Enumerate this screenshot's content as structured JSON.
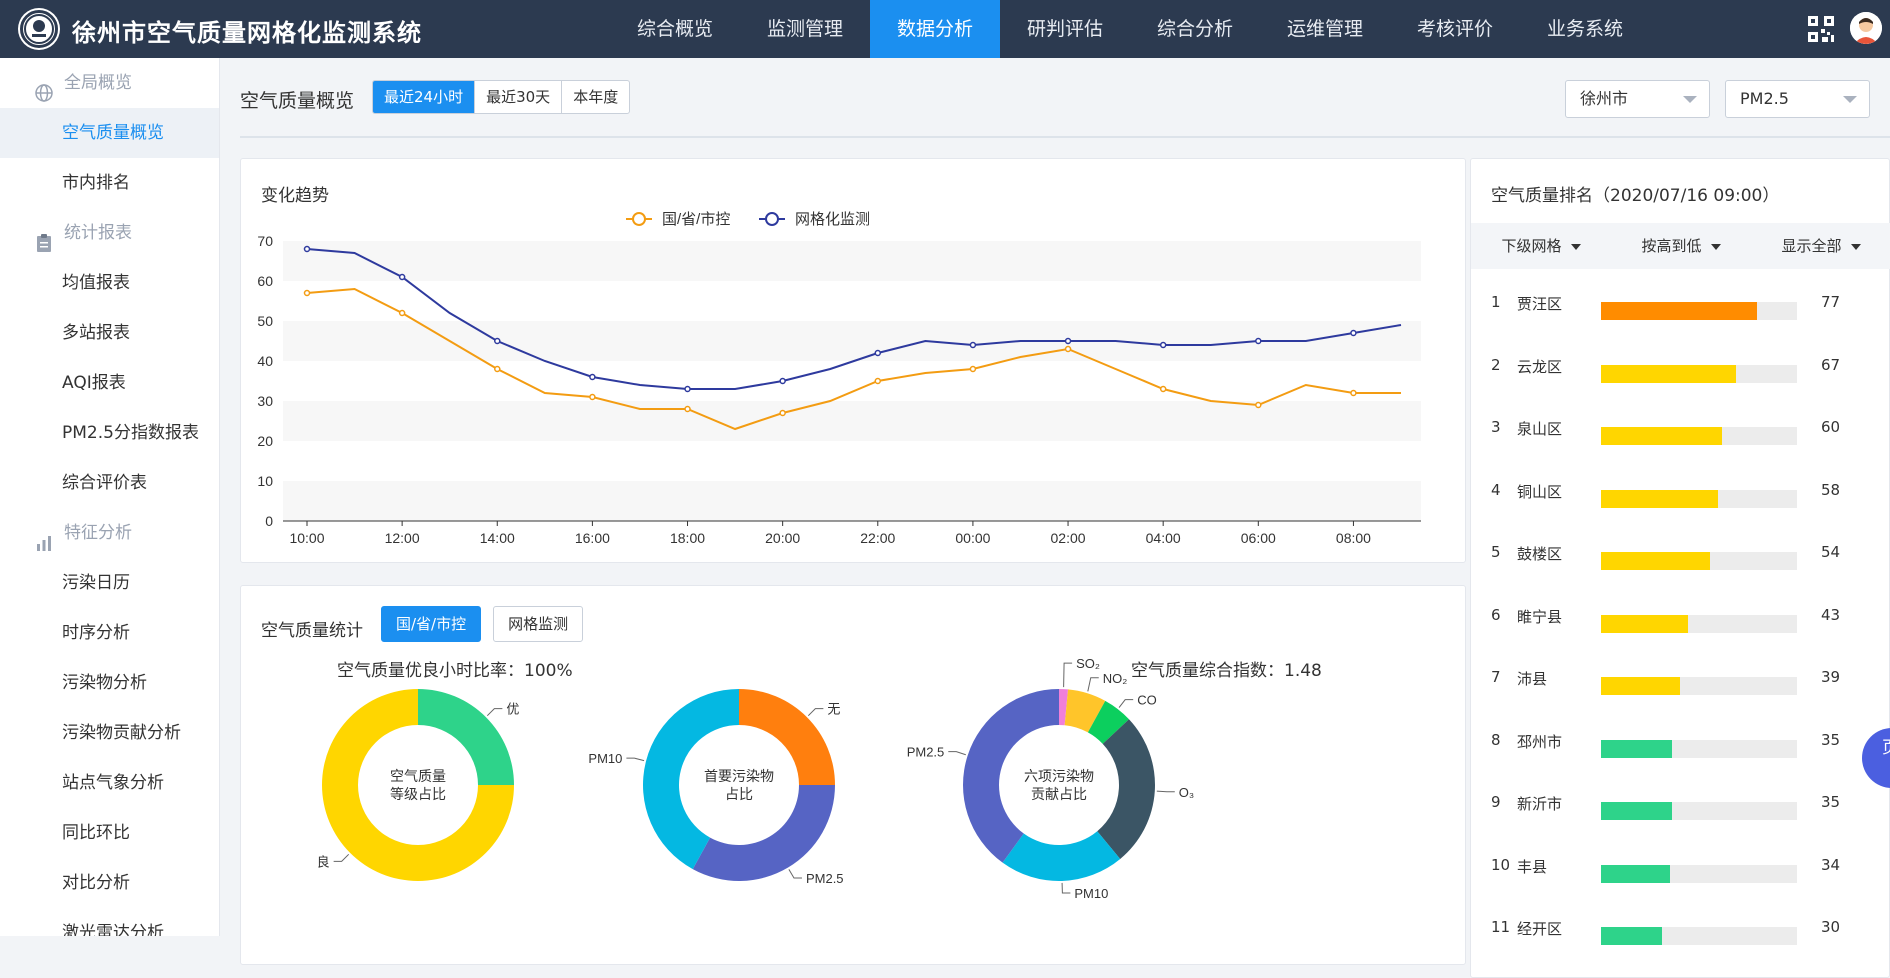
{
  "header": {
    "title": "徐州市空气质量网格化监测系统",
    "nav": [
      "综合概览",
      "监测管理",
      "数据分析",
      "研判评估",
      "综合分析",
      "运维管理",
      "考核评价",
      "业务系统"
    ],
    "active_nav": 2
  },
  "sidebar": {
    "items": [
      {
        "type": "group",
        "label": "全局概览",
        "icon": "globe-icon"
      },
      {
        "type": "item",
        "label": "空气质量概览",
        "active": true
      },
      {
        "type": "item",
        "label": "市内排名"
      },
      {
        "type": "group",
        "label": "统计报表",
        "icon": "clipboard-icon"
      },
      {
        "type": "item",
        "label": "均值报表"
      },
      {
        "type": "item",
        "label": "多站报表"
      },
      {
        "type": "item",
        "label": "AQI报表"
      },
      {
        "type": "item",
        "label": "PM2.5分指数报表"
      },
      {
        "type": "item",
        "label": "综合评价表"
      },
      {
        "type": "group",
        "label": "特征分析",
        "icon": "bar-chart-icon"
      },
      {
        "type": "item",
        "label": "污染日历"
      },
      {
        "type": "item",
        "label": "时序分析"
      },
      {
        "type": "item",
        "label": "污染物分析"
      },
      {
        "type": "item",
        "label": "污染物贡献分析"
      },
      {
        "type": "item",
        "label": "站点气象分析"
      },
      {
        "type": "item",
        "label": "同比环比"
      },
      {
        "type": "item",
        "label": "对比分析"
      },
      {
        "type": "item",
        "label": "激光雷达分析"
      }
    ]
  },
  "filter": {
    "page_title": "空气质量概览",
    "ranges": [
      "最近24小时",
      "最近30天",
      "本年度"
    ],
    "active_range": 0,
    "city": "徐州市",
    "pollutant": "PM2.5"
  },
  "trend": {
    "title": "变化趋势",
    "chart_data": {
      "type": "line",
      "x": [
        "10:00",
        "11:00",
        "12:00",
        "13:00",
        "14:00",
        "15:00",
        "16:00",
        "17:00",
        "18:00",
        "19:00",
        "20:00",
        "21:00",
        "22:00",
        "23:00",
        "00:00",
        "01:00",
        "02:00",
        "03:00",
        "04:00",
        "05:00",
        "06:00",
        "07:00",
        "08:00",
        "09:00"
      ],
      "tick_labels": [
        "10:00",
        "12:00",
        "14:00",
        "16:00",
        "18:00",
        "20:00",
        "22:00",
        "00:00",
        "02:00",
        "04:00",
        "06:00",
        "08:00"
      ],
      "ylim": [
        0,
        70
      ],
      "yticks": [
        0,
        10,
        20,
        30,
        40,
        50,
        60,
        70
      ],
      "legend_position": "top-center",
      "series": [
        {
          "name": "国/省/市控",
          "color": "#f39c12",
          "values": [
            57,
            58,
            52,
            45,
            38,
            32,
            31,
            28,
            28,
            23,
            27,
            30,
            35,
            37,
            38,
            41,
            43,
            38,
            33,
            30,
            29,
            34,
            32,
            32
          ]
        },
        {
          "name": "网格化监测",
          "color": "#2e3a9e",
          "values": [
            68,
            67,
            61,
            52,
            45,
            40,
            36,
            34,
            33,
            33,
            35,
            38,
            42,
            45,
            44,
            45,
            45,
            45,
            44,
            44,
            45,
            45,
            47,
            49
          ]
        }
      ]
    }
  },
  "stats": {
    "title": "空气质量统计",
    "toggles": [
      "国/省/市控",
      "网格监测"
    ],
    "active_toggle": 0,
    "good_rate_label": "空气质量优良小时比率：",
    "good_rate_value": "100%",
    "index_label": "空气质量综合指数：",
    "index_value": "1.48",
    "chart_data": [
      {
        "type": "pie",
        "center_label": [
          "空气质量",
          "等级占比"
        ],
        "slices": [
          {
            "label": "优",
            "value": 25,
            "color": "#2ed38a"
          },
          {
            "label": "良",
            "value": 75,
            "color": "#ffd600"
          }
        ]
      },
      {
        "type": "pie",
        "center_label": [
          "首要污染物",
          "占比"
        ],
        "slices": [
          {
            "label": "无",
            "value": 25,
            "color": "#ff7f0e"
          },
          {
            "label": "PM2.5",
            "value": 33,
            "color": "#5664c4"
          },
          {
            "label": "PM10",
            "value": 42,
            "color": "#04b8e2"
          }
        ]
      },
      {
        "type": "pie",
        "center_label": [
          "六项污染物",
          "贡献占比"
        ],
        "slices": [
          {
            "label": "SO₂",
            "value": 1.5,
            "color": "#f07fd9"
          },
          {
            "label": "NO₂",
            "value": 6.5,
            "color": "#ffc52a"
          },
          {
            "label": "CO",
            "value": 5,
            "color": "#0ccf5e"
          },
          {
            "label": "O₃",
            "value": 26,
            "color": "#3b5565"
          },
          {
            "label": "PM10",
            "value": 21,
            "color": "#04b8e2"
          },
          {
            "label": "PM2.5",
            "value": 40,
            "color": "#5664c4"
          }
        ]
      }
    ]
  },
  "ranking": {
    "title": "空气质量排名（2020/07/16 09:00）",
    "headers": [
      "下级网格",
      "按高到低",
      "显示全部"
    ],
    "max": 97,
    "rows": [
      {
        "rank": "1",
        "name": "贾汪区",
        "value": 77,
        "color": "#ff8c00"
      },
      {
        "rank": "2",
        "name": "云龙区",
        "value": 67,
        "color": "#ffd600"
      },
      {
        "rank": "3",
        "name": "泉山区",
        "value": 60,
        "color": "#ffd600"
      },
      {
        "rank": "4",
        "name": "铜山区",
        "value": 58,
        "color": "#ffd600"
      },
      {
        "rank": "5",
        "name": "鼓楼区",
        "value": 54,
        "color": "#ffd600"
      },
      {
        "rank": "6",
        "name": "睢宁县",
        "value": 43,
        "color": "#ffd600"
      },
      {
        "rank": "7",
        "name": "沛县",
        "value": 39,
        "color": "#ffd600"
      },
      {
        "rank": "8",
        "name": "邳州市",
        "value": 35,
        "color": "#2ed38a"
      },
      {
        "rank": "9",
        "name": "新沂市",
        "value": 35,
        "color": "#2ed38a"
      },
      {
        "rank": "10",
        "name": "丰县",
        "value": 34,
        "color": "#2ed38a"
      },
      {
        "rank": "11",
        "name": "经开区",
        "value": 30,
        "color": "#2ed38a"
      }
    ]
  },
  "float_button": {
    "label": "页说"
  }
}
